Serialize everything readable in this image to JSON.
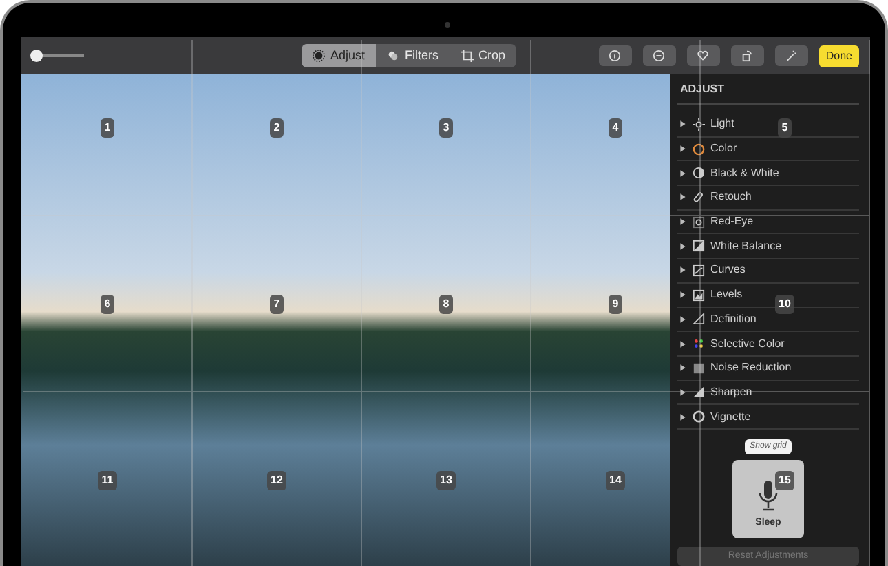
{
  "toolbar": {
    "zoom_slider": {
      "level": 0.08
    },
    "tabs": [
      {
        "label": "Adjust",
        "selected": true
      },
      {
        "label": "Filters",
        "selected": false
      },
      {
        "label": "Crop",
        "selected": false
      }
    ],
    "done_button": "Done"
  },
  "sidebar": {
    "heading": "ADJUST",
    "items": [
      {
        "label": "Light",
        "expanded": false
      },
      {
        "label": "Color",
        "expanded": false
      },
      {
        "label": "Black & White",
        "expanded": false
      },
      {
        "label": "Retouch",
        "expanded": false
      },
      {
        "label": "Red-Eye",
        "expanded": false
      },
      {
        "label": "White Balance",
        "expanded": false
      },
      {
        "label": "Curves",
        "expanded": false
      },
      {
        "label": "Levels",
        "expanded": false
      },
      {
        "label": "Definition",
        "expanded": false
      },
      {
        "label": "Selective Color",
        "expanded": false
      },
      {
        "label": "Noise Reduction",
        "expanded": false
      },
      {
        "label": "Sharpen",
        "expanded": false
      },
      {
        "label": "Vignette",
        "expanded": false
      }
    ],
    "tooltip": "Show grid",
    "voice_command": "Sleep",
    "reset_button": {
      "label": "Reset Adjustments",
      "disabled": true
    }
  },
  "grid_numbers": [
    "1",
    "2",
    "3",
    "4",
    "5",
    "6",
    "7",
    "8",
    "9",
    "10",
    "11",
    "12",
    "13",
    "14",
    "15"
  ]
}
